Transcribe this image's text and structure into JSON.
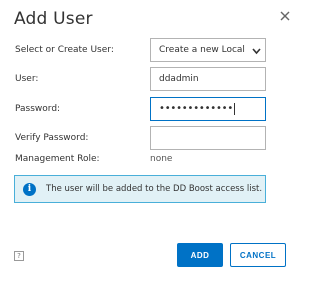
{
  "dialog": {
    "title": "Add User",
    "close_icon": "close-icon"
  },
  "form": {
    "select_user": {
      "label": "Select or Create User:",
      "value": "Create a new Local U"
    },
    "user": {
      "label": "User:",
      "value": "ddadmin"
    },
    "password": {
      "label": "Password:",
      "masked_value": "•••••••••••••"
    },
    "verify_password": {
      "label": "Verify Password:",
      "value": ""
    },
    "management_role": {
      "label": "Management Role:",
      "value": "none"
    }
  },
  "info": {
    "icon": "info-icon",
    "text": "The user will be added to the DD Boost access list."
  },
  "footer": {
    "help_label": "?",
    "add_label": "ADD",
    "cancel_label": "CANCEL"
  },
  "colors": {
    "accent": "#0072c6",
    "info_background": "#e1f1f6",
    "info_border": "#49afd9"
  }
}
